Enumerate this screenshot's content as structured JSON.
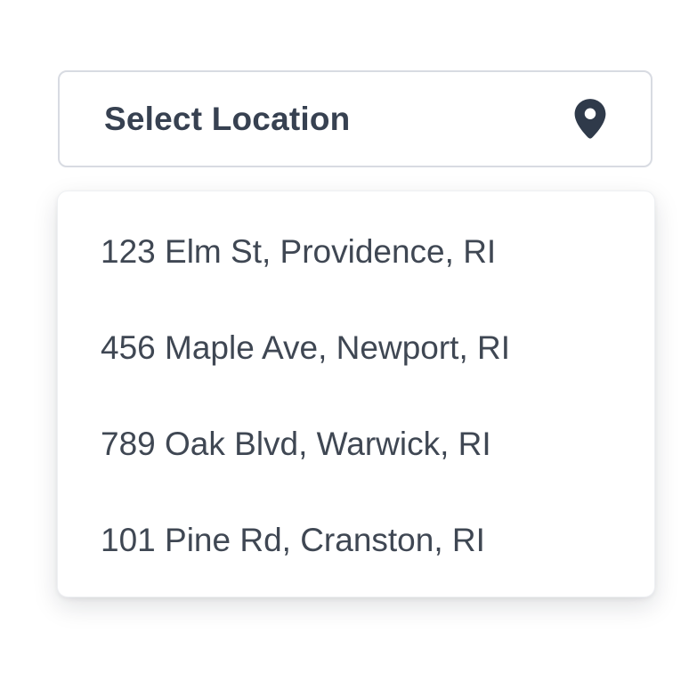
{
  "select": {
    "label": "Select Location",
    "icon": "map-pin-icon"
  },
  "dropdown": {
    "options": [
      {
        "label": "123 Elm St, Providence, RI"
      },
      {
        "label": "456 Maple Ave, Newport, RI"
      },
      {
        "label": "789 Oak Blvd, Warwick, RI"
      },
      {
        "label": "101 Pine Rd, Cranston, RI"
      }
    ]
  },
  "colors": {
    "text_primary": "#374151",
    "text_option": "#3f4753",
    "border": "#d8dbe2",
    "icon": "#2f3a4a"
  }
}
